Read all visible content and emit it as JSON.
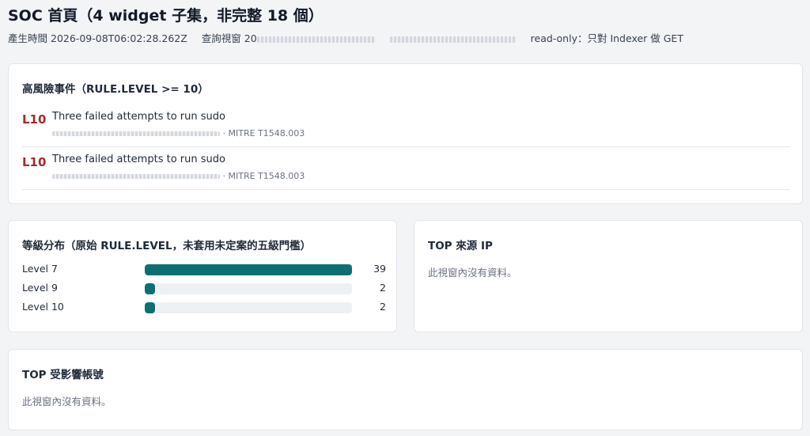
{
  "header": {
    "title": "SOC 首頁（4 widget 子集，非完整 18 個）",
    "generated_label": "產生時間",
    "generated_value": "2026-09-08T06:02:28.262Z",
    "window_label": "查詢視窗",
    "window_value_prefix": "20",
    "readonly_note": "read-only：只對 Indexer 做 GET"
  },
  "events": {
    "title": "高風險事件（RULE.LEVEL >= 10）",
    "items": [
      {
        "level": "L10",
        "description": "Three failed attempts to run sudo",
        "mitre": "· MITRE T1548.003"
      },
      {
        "level": "L10",
        "description": "Three failed attempts to run sudo",
        "mitre": "· MITRE T1548.003"
      }
    ]
  },
  "levels": {
    "title": "等級分布（原始 RULE.LEVEL，未套用未定案的五級門檻）",
    "max": 39,
    "items": [
      {
        "label": "Level 7",
        "count": 39
      },
      {
        "label": "Level 9",
        "count": 2
      },
      {
        "label": "Level 10",
        "count": 2
      }
    ]
  },
  "top_ip": {
    "title": "TOP 來源 IP",
    "empty_text": "此視窗內沒有資料。"
  },
  "top_accounts": {
    "title": "TOP 受影響帳號",
    "empty_text": "此視窗內沒有資料。"
  },
  "colors": {
    "bar_fill": "#0e6f73",
    "bar_track": "#eef1f4",
    "level_high": "#a52a2a"
  }
}
